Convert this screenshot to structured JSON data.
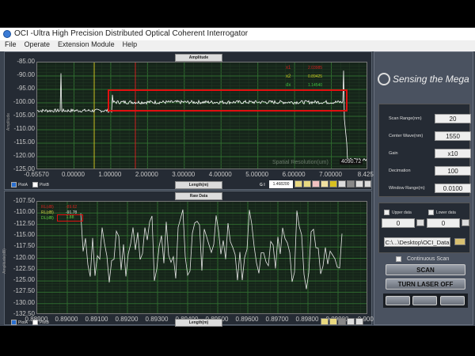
{
  "window": {
    "title": "OCI -Ultra High Precision Distributed Optical Coherent Interrogator"
  },
  "menu": [
    "File",
    "Operate",
    "Extension Module",
    "Help"
  ],
  "top_chart": {
    "tab": "Amplitude",
    "ylabel": "Amplitude",
    "xlabel": "Length(m)",
    "yticks": [
      "-85.00",
      "-90.00",
      "-95.00",
      "-100.00",
      "-105.00",
      "-110.00",
      "-115.00",
      "-120.00",
      "-125.00"
    ],
    "xticks": [
      "-0.65570",
      "0.00000",
      "1.00000",
      "2.00000",
      "3.00000",
      "4.00000",
      "5.00000",
      "6.00000",
      "7.00000",
      "8.4253"
    ],
    "cursors": {
      "x1_label": "x1",
      "x1": "2.03985",
      "x2_label": "x2",
      "x2": "0.89425",
      "dx_label": "dx",
      "dx": "1.14540"
    },
    "spatial_resolution_label": "Spatial Resolution(um)",
    "spatial_resolution": "4090.72",
    "plotA": "PlotA",
    "plotB": "PlotB",
    "gi_label": "G I",
    "gi_value": "1.468200"
  },
  "bottom_chart": {
    "tab": "Raw Data",
    "ylabel": "Amplitude(dB)",
    "xlabel": "Length(m)",
    "yticks": [
      "-107.50",
      "-110.00",
      "-112.50",
      "-115.00",
      "-117.50",
      "-120.00",
      "-122.50",
      "-125.00",
      "-127.50",
      "-130.00",
      "-132.50"
    ],
    "xticks": [
      "0.88900",
      "0.89000",
      "0.89100",
      "0.89200",
      "0.89300",
      "0.89400",
      "0.89500",
      "0.89600",
      "0.89700",
      "0.89800",
      "0.89900",
      "0.9000"
    ],
    "readouts": [
      {
        "label": "RL(dB)",
        "value": "-89.62"
      },
      {
        "label": "RL(dB)",
        "value": "-91.78"
      },
      {
        "label": "DL(dB)",
        "value": "1.88"
      }
    ],
    "plotA": "PlotA",
    "plotB": "PlotB"
  },
  "right": {
    "brand": "Sensing the Mega",
    "params": [
      {
        "label": "Scan Range(nm)",
        "value": "20"
      },
      {
        "label": "Center Wave(nm)",
        "value": "1550"
      },
      {
        "label": "Gain",
        "value": "x10"
      },
      {
        "label": "Decimation",
        "value": "100"
      },
      {
        "label": "Window Range(m)",
        "value": "0.0100"
      }
    ],
    "upper_label": "Upper data",
    "upper_value": "0",
    "lower_label": "Lower data",
    "lower_value": "0",
    "path": "C:\\...\\Desktop\\OCI_Data",
    "continuous": "Continuous Scan",
    "scan": "SCAN",
    "laser": "TURN LASER OFF"
  },
  "colors": {
    "grid": "#2f6a2f",
    "x1": "#d02020",
    "x2": "#c8c020",
    "dx": "#40c040",
    "trace": "#ffffff"
  }
}
